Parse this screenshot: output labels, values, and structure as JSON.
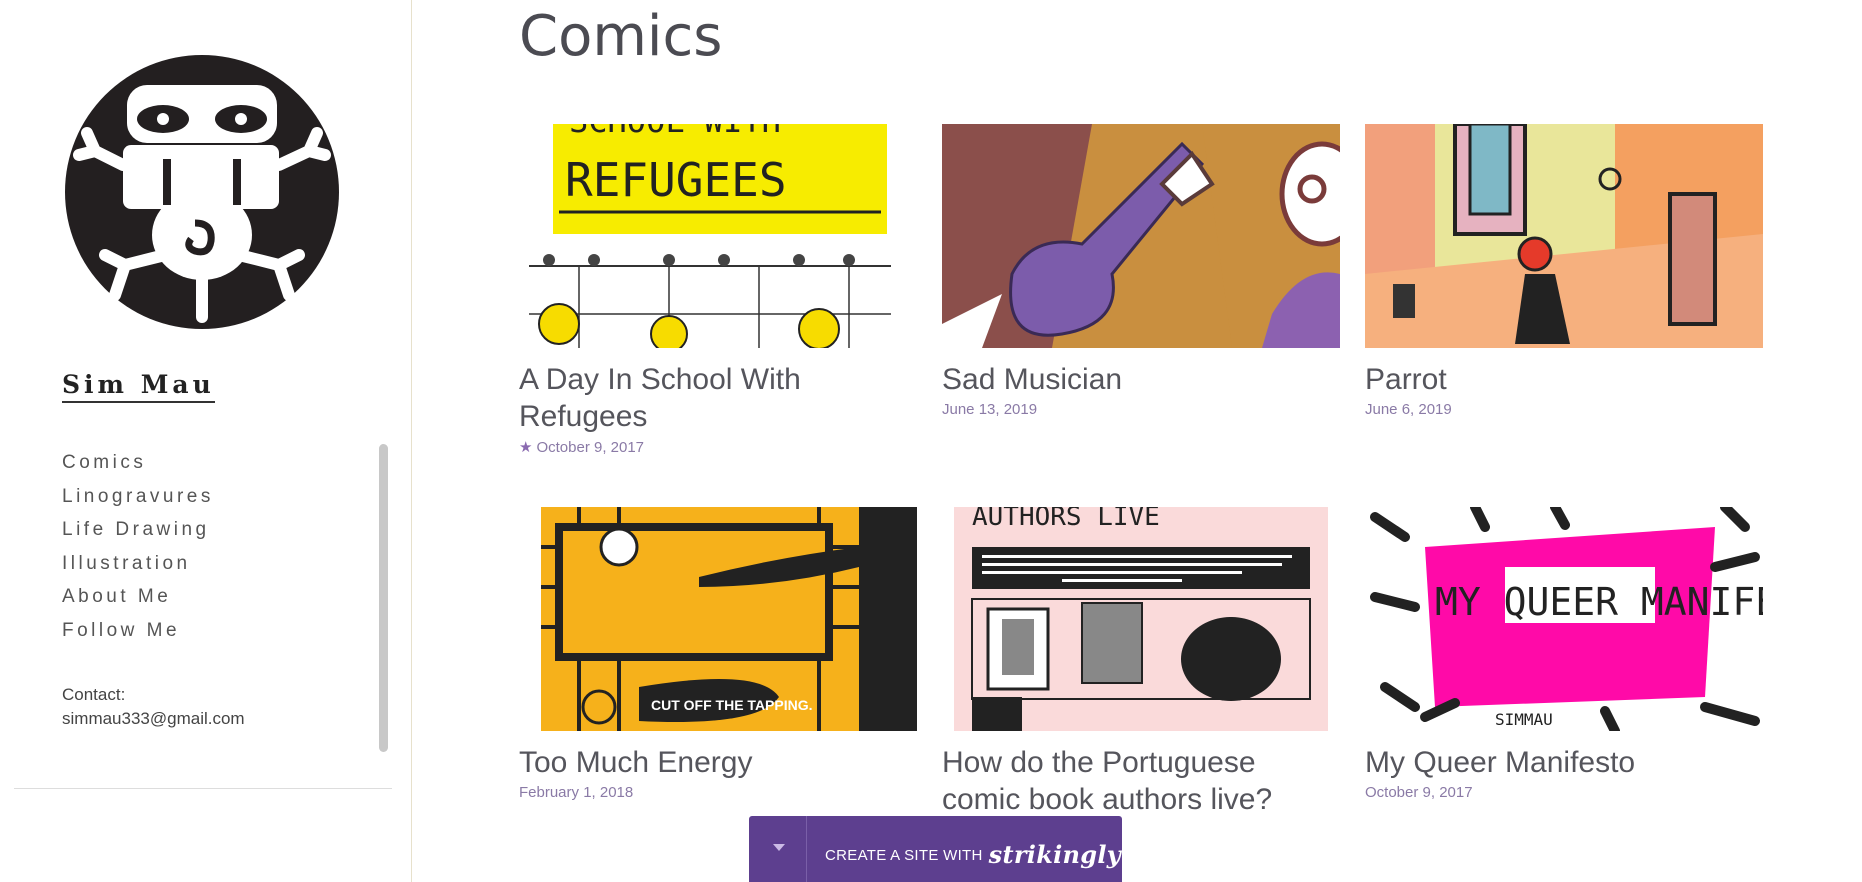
{
  "site": {
    "name": "Sim Mau",
    "contact_label": "Contact:",
    "contact_email": "simmau333@gmail.com"
  },
  "nav": [
    {
      "label": "Comics"
    },
    {
      "label": "Linogravures"
    },
    {
      "label": "Life Drawing"
    },
    {
      "label": "Illustration"
    },
    {
      "label": "About Me"
    },
    {
      "label": "Follow Me"
    }
  ],
  "page": {
    "title": "Comics"
  },
  "posts": [
    {
      "title": "A Day In School With Refugees",
      "date": "October 9, 2017",
      "featured": true,
      "thumb_text": "REFUGEES",
      "thumb_text_top": "SCHOOL WITH"
    },
    {
      "title": "Sad Musician",
      "date": "June 13, 2019"
    },
    {
      "title": "Parrot",
      "date": "June 6, 2019"
    },
    {
      "title": "Too Much Energy",
      "date": "February 1, 2018",
      "thumb_text": "CUT OFF THE TAPPING."
    },
    {
      "title": "How do the Portuguese comic book authors live?",
      "date": "",
      "thumb_text_top": "AUTHORS LIVE"
    },
    {
      "title": "My Queer Manifesto",
      "date": "October 9, 2017",
      "thumb_text": "MY QUEER MANIFESTO",
      "thumb_text_sig": "SIMMAU"
    }
  ],
  "banner": {
    "cta": "CREATE A SITE WITH",
    "brand": "strikingly"
  },
  "icons": {
    "featured": "star-icon",
    "toggle": "caret-down-icon",
    "logo": "sim-mau-logo"
  },
  "colors": {
    "accent": "#5d3f8f",
    "date": "#8a7aa6",
    "refugees_yellow": "#f7ec00",
    "magenta": "#ff0aa8",
    "orange": "#f6b11b"
  }
}
